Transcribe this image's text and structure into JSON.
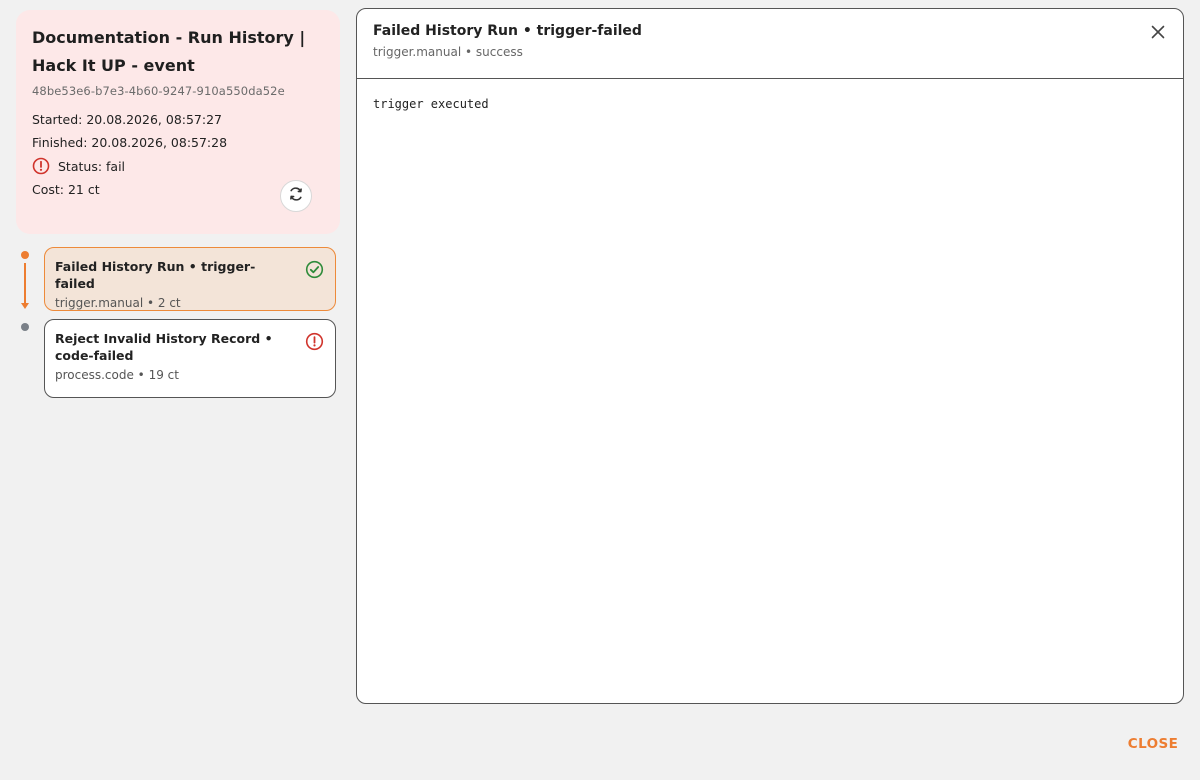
{
  "summary": {
    "title": "Documentation - Run History | Hack It UP - event",
    "run_id": "48be53e6-b7e3-4b60-9247-910a550da52e",
    "started": "Started: 20.08.2026, 08:57:27",
    "finished": "Finished: 20.08.2026, 08:57:28",
    "status": "Status: fail",
    "cost": "Cost: 21 ct"
  },
  "steps": [
    {
      "title": "Failed History Run • trigger-failed",
      "subtitle": "trigger.manual • 2 ct",
      "state": "success",
      "selected": true
    },
    {
      "title": "Reject Invalid History Record • code-failed",
      "subtitle": "process.code • 19 ct",
      "state": "error",
      "selected": false
    }
  ],
  "detail": {
    "title": "Failed History Run • trigger-failed",
    "subtitle": "trigger.manual • success",
    "output": "trigger executed"
  },
  "footer": {
    "close_label": "CLOSE"
  },
  "icons": {
    "status": "alert-circle-icon",
    "refresh": "refresh-icon",
    "success": "check-circle-icon",
    "error": "alert-circle-icon",
    "close": "close-icon"
  },
  "colors": {
    "accent": "#ed7d31",
    "error": "#d0342c",
    "success": "#2e8b3a",
    "summary_bg": "#fde8e8",
    "selected_step_bg": "#f3e4d8"
  }
}
